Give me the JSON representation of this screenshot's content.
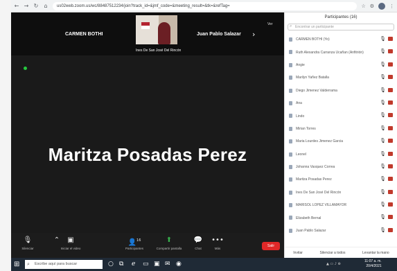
{
  "browser": {
    "url": "us02web.zoom.us/wc/88487512234/join?track_id=&jmf_code=&meeting_result=&tk=&refTag=",
    "back_icon": "back-arrow-icon",
    "forward_icon": "forward-arrow-icon",
    "reload_icon": "reload-icon",
    "home_icon": "home-icon"
  },
  "meeting": {
    "thumbnails": [
      {
        "name": "CARMEN BOTHI"
      },
      {
        "name": "Juan Pablo Salazar"
      }
    ],
    "video_caption": "Ines De San José Del Rincón",
    "view_label": "Ver",
    "active_speaker": "Maritza Posadas Perez"
  },
  "toolbar": {
    "mute_label": "Silenciar",
    "video_label": "Iniciar el video",
    "participants_label": "Participantes",
    "participants_count": "16",
    "share_label": "Compartir pantalla",
    "chat_label": "Chat",
    "more_label": "Más",
    "end_label": "Salir"
  },
  "panel": {
    "title": "Participantes (16)",
    "search_placeholder": "Encontrar un participante",
    "participants": [
      {
        "name": "CARMEN BOTHI (Yo)"
      },
      {
        "name": "Ruth Alexandra Carranza Ucañan (Anfitrión)"
      },
      {
        "name": "Angie"
      },
      {
        "name": "Marilyn Yañez Batalla"
      },
      {
        "name": "Diego Jimenez Valderrama"
      },
      {
        "name": "Ana"
      },
      {
        "name": "Lindo"
      },
      {
        "name": "Mirian Torres"
      },
      {
        "name": "Maria Lourdes Jimenez Garcia"
      },
      {
        "name": "Leonel"
      },
      {
        "name": "Johanna Vasquez Correa"
      },
      {
        "name": "Maritza Posadas Perez"
      },
      {
        "name": "Ines De San José Del Rincón"
      },
      {
        "name": "MARISOL LOPEZ VILLAMAYOR"
      },
      {
        "name": "Elizabeth Bernal"
      },
      {
        "name": "Juan Pablo Salazar"
      }
    ],
    "invite_label": "Invitar",
    "mute_all_label": "Silenciar a todos",
    "raise_hand_label": "Levantar la mano"
  },
  "taskbar": {
    "search_placeholder": "Escribe aquí para buscar",
    "time": "11:07 a. m.",
    "date": "20/4/2021"
  }
}
